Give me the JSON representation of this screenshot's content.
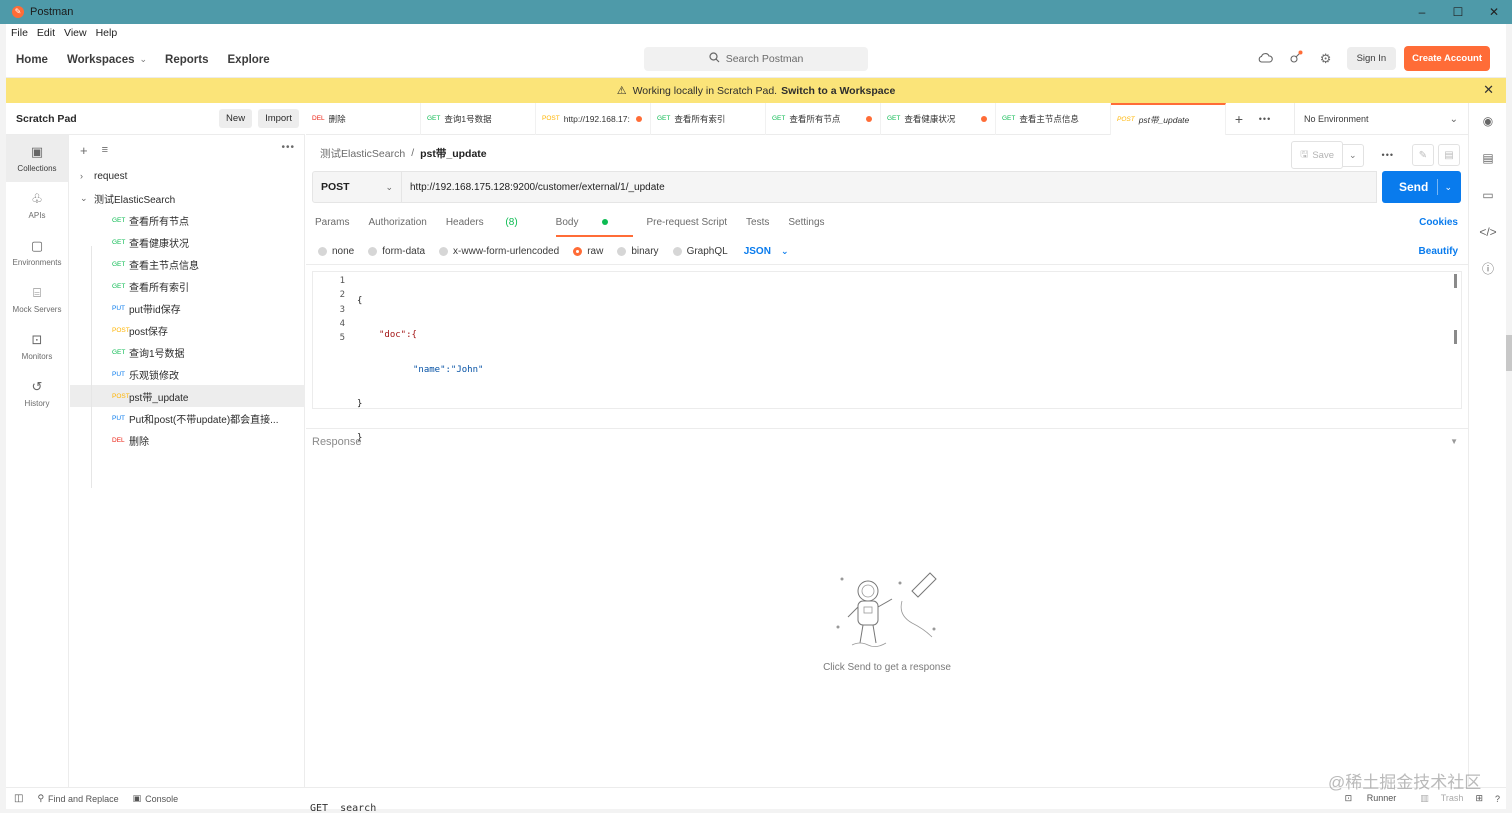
{
  "window": {
    "title": "Postman",
    "controls": [
      "–",
      "☐",
      "✕"
    ]
  },
  "menu": [
    "File",
    "Edit",
    "View",
    "Help"
  ],
  "header": {
    "nav": {
      "home": "Home",
      "workspaces": "Workspaces",
      "reports": "Reports",
      "explore": "Explore"
    },
    "search_placeholder": "Search Postman",
    "sign_in": "Sign In",
    "create_account": "Create Account"
  },
  "banner": {
    "text": "Working locally in Scratch Pad.",
    "link": "Switch to a Workspace"
  },
  "sidebar": {
    "title": "Scratch Pad",
    "new_label": "New",
    "import_label": "Import",
    "rail": [
      {
        "label": "Collections",
        "icon": "collections-icon"
      },
      {
        "label": "APIs",
        "icon": "apis-icon"
      },
      {
        "label": "Environments",
        "icon": "environments-icon"
      },
      {
        "label": "Mock Servers",
        "icon": "mock-servers-icon"
      },
      {
        "label": "Monitors",
        "icon": "monitors-icon"
      },
      {
        "label": "History",
        "icon": "history-icon"
      }
    ],
    "collections": [
      {
        "name": "request"
      },
      {
        "name": "测试ElasticSearch"
      }
    ],
    "requests": [
      {
        "method": "GET",
        "name": "查看所有节点"
      },
      {
        "method": "GET",
        "name": "查看健康状况"
      },
      {
        "method": "GET",
        "name": "查看主节点信息"
      },
      {
        "method": "GET",
        "name": "查看所有索引"
      },
      {
        "method": "PUT",
        "name": "put带id保存"
      },
      {
        "method": "POST",
        "name": "post保存"
      },
      {
        "method": "GET",
        "name": "查询1号数据"
      },
      {
        "method": "PUT",
        "name": "乐观锁修改"
      },
      {
        "method": "POST",
        "name": "pst带_update"
      },
      {
        "method": "PUT",
        "name": "Put和post(不带update)都会直接..."
      },
      {
        "method": "DEL",
        "name": "删除"
      }
    ]
  },
  "tabs": [
    {
      "method": "DEL",
      "name": "删除"
    },
    {
      "method": "GET",
      "name": "查询1号数据"
    },
    {
      "method": "POST",
      "name": "http://192.168.17:"
    },
    {
      "method": "GET",
      "name": "查看所有索引"
    },
    {
      "method": "GET",
      "name": "查看所有节点"
    },
    {
      "method": "GET",
      "name": "查看健康状况"
    },
    {
      "method": "GET",
      "name": "查看主节点信息"
    },
    {
      "method": "POST",
      "name": "pst带_update"
    }
  ],
  "environment": "No Environment",
  "request": {
    "breadcrumb_parent": "测试ElasticSearch",
    "breadcrumb_sep": "/",
    "name": "pst带_update",
    "save_label": "Save",
    "method": "POST",
    "url": "http://192.168.175.128:9200/customer/external/1/_update",
    "send_label": "Send"
  },
  "request_tabs": {
    "params": "Params",
    "authorization": "Authorization",
    "headers": "Headers",
    "headers_count": "(8)",
    "body": "Body",
    "prerequest": "Pre-request Script",
    "tests": "Tests",
    "settings": "Settings",
    "cookies": "Cookies"
  },
  "body_types": {
    "none": "none",
    "form_data": "form-data",
    "urlencoded": "x-www-form-urlencoded",
    "raw": "raw",
    "binary": "binary",
    "graphql": "GraphQL",
    "format": "JSON",
    "beautify": "Beautify"
  },
  "editor": {
    "line_numbers": [
      "1",
      "2",
      "3",
      "4",
      "5"
    ],
    "lines": [
      "{",
      "\"doc\":{",
      "\"name\":\"John\"",
      "}",
      "}"
    ]
  },
  "response": {
    "title": "Response",
    "hint": "Click Send to get a response"
  },
  "statusbar": {
    "find_replace": "Find and Replace",
    "console": "Console",
    "runner": "Runner",
    "trash": "Trash"
  },
  "watermark": "@稀土掘金技术社区",
  "peek_text": "GET _search",
  "colors": {
    "accent": "#ff6c37",
    "send": "#097bed",
    "banner": "#fbe479",
    "titlebar": "#4e9aa9"
  }
}
